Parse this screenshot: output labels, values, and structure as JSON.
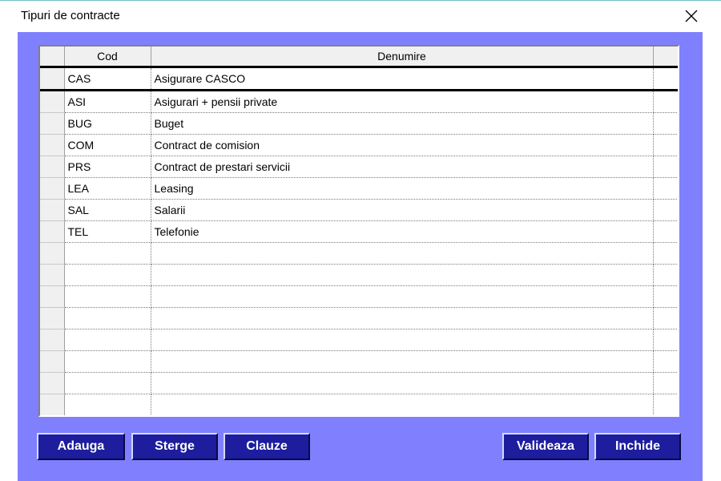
{
  "window": {
    "title": "Tipuri de contracte"
  },
  "grid": {
    "columns": [
      "Cod",
      "Denumire"
    ],
    "rows": [
      {
        "cod": "CAS",
        "denumire": "Asigurare CASCO"
      },
      {
        "cod": "ASI",
        "denumire": "Asigurari + pensii private"
      },
      {
        "cod": "BUG",
        "denumire": "Buget"
      },
      {
        "cod": "COM",
        "denumire": "Contract de comision"
      },
      {
        "cod": "PRS",
        "denumire": "Contract de prestari servicii"
      },
      {
        "cod": "LEA",
        "denumire": "Leasing"
      },
      {
        "cod": "SAL",
        "denumire": "Salarii"
      },
      {
        "cod": "TEL",
        "denumire": "Telefonie"
      }
    ]
  },
  "buttons": {
    "adauga": "Adauga",
    "sterge": "Sterge",
    "clauze": "Clauze",
    "valideaza": "Valideaza",
    "inchide": "Inchide"
  },
  "colors": {
    "client_bg": "#8080ff",
    "button_bg": "#1d1d9e",
    "button_text": "#ffffff"
  },
  "icons": {
    "close": "close-icon"
  }
}
